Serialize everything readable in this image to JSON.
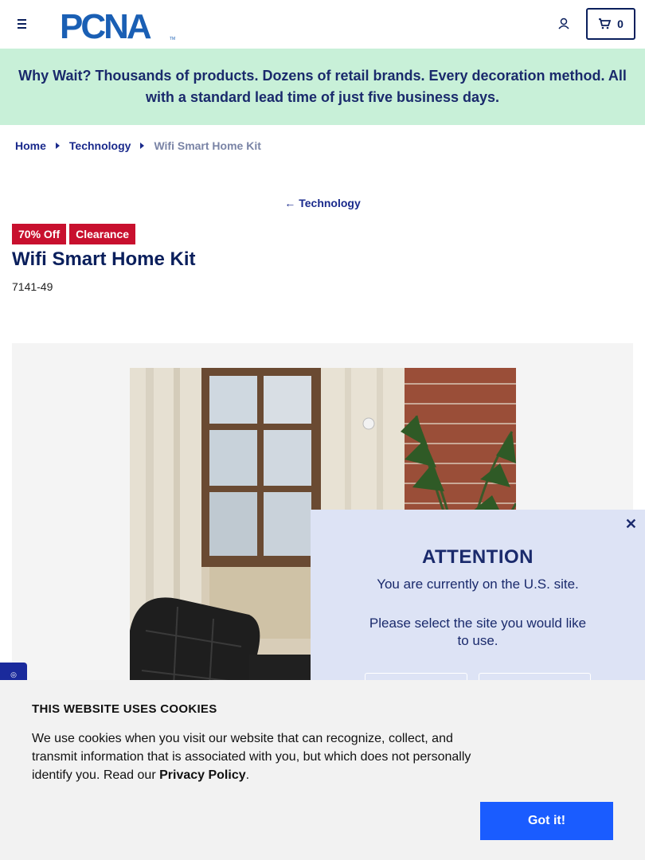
{
  "header": {
    "logo_text": "PCNA",
    "logo_tm": "TM",
    "cart_count": "0"
  },
  "promo": {
    "text": "Why Wait? Thousands of products. Dozens of retail brands. Every decoration method. All with a standard lead time of just five business days."
  },
  "breadcrumb": {
    "items": [
      "Home",
      "Technology"
    ],
    "current": "Wifi Smart Home Kit"
  },
  "back_link": {
    "label": "Technology"
  },
  "product": {
    "badges": [
      "70% Off",
      "Clearance"
    ],
    "title": "Wifi Smart Home Kit",
    "sku": "7141-49"
  },
  "modal": {
    "heading": "ATTENTION",
    "line1": "You are currently on the U.S. site.",
    "line2": "Please select the site you would like to use."
  },
  "cookie": {
    "heading": "THIS WEBSITE USES COOKIES",
    "body": "We use cookies when you visit our website that can recognize, collect, and transmit information that is associated with you, but which does not personally identify you. Read our ",
    "link": "Privacy Policy",
    "end": ".",
    "button": "Got it!"
  },
  "colors": {
    "brand_navy": "#0a1f5c",
    "promo_bg": "#c8f0d8",
    "badge_red": "#c8102e",
    "cta_blue": "#1a5cff"
  }
}
